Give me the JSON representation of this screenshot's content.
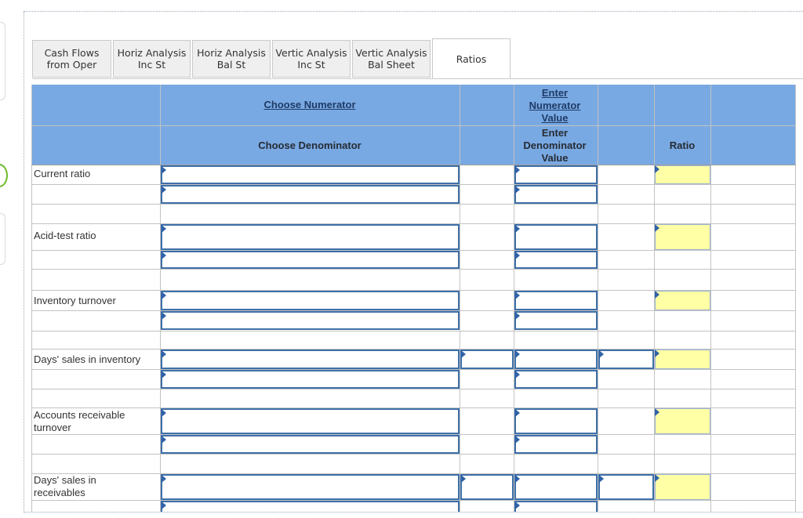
{
  "tabs": [
    {
      "label": "Cash Flows\nfrom Oper",
      "active": false
    },
    {
      "label": "Horiz Analysis\nInc St",
      "active": false
    },
    {
      "label": "Horiz Analysis\nBal St",
      "active": false
    },
    {
      "label": "Vertic Analysis\nInc St",
      "active": false
    },
    {
      "label": "Vertic Analysis\nBal Sheet",
      "active": false
    },
    {
      "label": "Ratios",
      "active": true
    }
  ],
  "header": {
    "choose_numerator": "Choose Numerator",
    "choose_denominator": "Choose Denominator",
    "enter_numerator": "Enter\nNumerator\nValue",
    "enter_denominator": "Enter\nDenominator\nValue",
    "ratio": "Ratio"
  },
  "ratios": [
    {
      "label": "Current ratio",
      "numerator": "",
      "denominator": "",
      "ratio": ""
    },
    {
      "label": "Acid-test ratio",
      "numerator": "",
      "denominator": "",
      "ratio": ""
    },
    {
      "label": "Inventory turnover",
      "numerator": "",
      "denominator": "",
      "ratio": ""
    },
    {
      "label": "Days' sales in inventory",
      "numerator": "",
      "denominator": "",
      "ratio": ""
    },
    {
      "label": "Accounts receivable\nturnover",
      "numerator": "",
      "denominator": "",
      "ratio": ""
    },
    {
      "label": "Days' sales in\nreceivables",
      "numerator": "",
      "denominator": "",
      "ratio": ""
    }
  ],
  "colors": {
    "header_blue": "#79a9e3",
    "ratio_cell": "#ffffa6",
    "input_border": "#3e6fa8"
  }
}
